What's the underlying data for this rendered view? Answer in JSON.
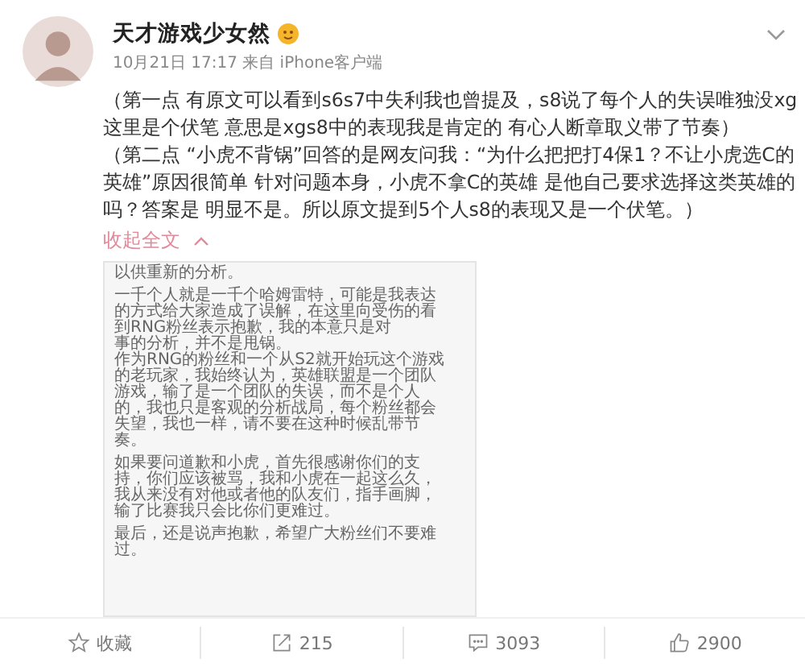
{
  "post": {
    "author": "天才游戏少女然",
    "meta": "10月21日 17:17 来自 iPhone客户端",
    "paragraphs": [
      "（第一点 有原文可以看到s6s7中失利我也曾提及，s8说了每个人的失误唯独没xg这里是个伏笔 意思是xgs8中的表现我是肯定的 有心人断章取义带了节奏）",
      "（第二点 “小虎不背锅”回答的是网友问我：“为什么把把打4保1？不让小虎选C的英雄”原因很简单 针对问题本身，小虎不拿C的英雄 是他自己要求选择这类英雄的吗？答案是 明显不是。所以原文提到5个人s8的表现又是一个伏笔。）"
    ],
    "collapse_link": "收起全文",
    "document_blocks": [
      [
        "以供重新的分析。"
      ],
      [
        "一千个人就是一千个哈姆雷特，可能是我表达",
        "的方式给大家造成了误解，在这里向受伤的看",
        "到RNG粉丝表示抱歉，我的本意只是对",
        "事的分析，并不是甩锅。",
        "作为RNG的粉丝和一个从S2就开始玩这个游戏",
        "的老玩家，我始终认为，英雄联盟是一个团队",
        "游戏，输了是一个团队的失误，而不是个人",
        "的，我也只是客观的分析战局，每个粉丝都会",
        "失望，我也一样，请不要在这种时候乱带节",
        "奏。"
      ],
      [
        "如果要问道歉和小虎，首先很感谢你们的支",
        "持，你们应该被骂，我和小虎在一起这么久，",
        "我从来没有对他或者他的队友们，指手画脚，",
        "输了比赛我只会比你们更难过。"
      ],
      [
        "最后，还是说声抱歉，希望广大粉丝们不要难",
        "过。"
      ]
    ]
  },
  "actions": [
    {
      "kind": "favorite",
      "label": "收藏"
    },
    {
      "kind": "share",
      "label": "215"
    },
    {
      "kind": "comment",
      "label": "3093"
    },
    {
      "kind": "like",
      "label": "2900"
    }
  ]
}
